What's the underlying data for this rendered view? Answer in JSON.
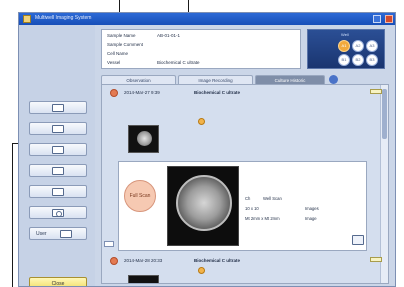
{
  "window": {
    "title": "Multiwell Imaging System"
  },
  "info": {
    "rows": [
      {
        "label": "Sample Name",
        "value": "AB-01-01-1"
      },
      {
        "label": "Sample Comment",
        "value": ""
      },
      {
        "label": "Cell Name",
        "value": ""
      },
      {
        "label": "Vessel",
        "value": "Biochemical C ultrate"
      }
    ]
  },
  "plate": {
    "label": "Well",
    "wells": [
      {
        "id": "A1",
        "active": true
      },
      {
        "id": "A2",
        "active": false
      },
      {
        "id": "A3",
        "active": false
      },
      {
        "id": "B1",
        "active": false
      },
      {
        "id": "B2",
        "active": false
      },
      {
        "id": "B3",
        "active": false
      }
    ]
  },
  "tabs": [
    {
      "label": "Observation",
      "selected": false
    },
    {
      "label": "Image Recording",
      "selected": false
    },
    {
      "label": "Culture Historic",
      "selected": true
    }
  ],
  "records": [
    {
      "datetime": "2014-Mar-27 9:39",
      "vessel": "Biochemical C ultrate"
    },
    {
      "datetime": "2014-Mar-28 20:33",
      "vessel": "Biochemical C ultrate"
    }
  ],
  "detail": {
    "fullscan_label": "Full Scan",
    "scan_info": [
      {
        "label": "Ch",
        "value": "Well Scan"
      },
      {
        "label": "10 x 10",
        "value": "Images"
      },
      {
        "label": "Mt 2mm x Mt 2mm",
        "value": "Image"
      }
    ]
  },
  "left_panel": {
    "user_label": "User",
    "close_label": "Close"
  }
}
